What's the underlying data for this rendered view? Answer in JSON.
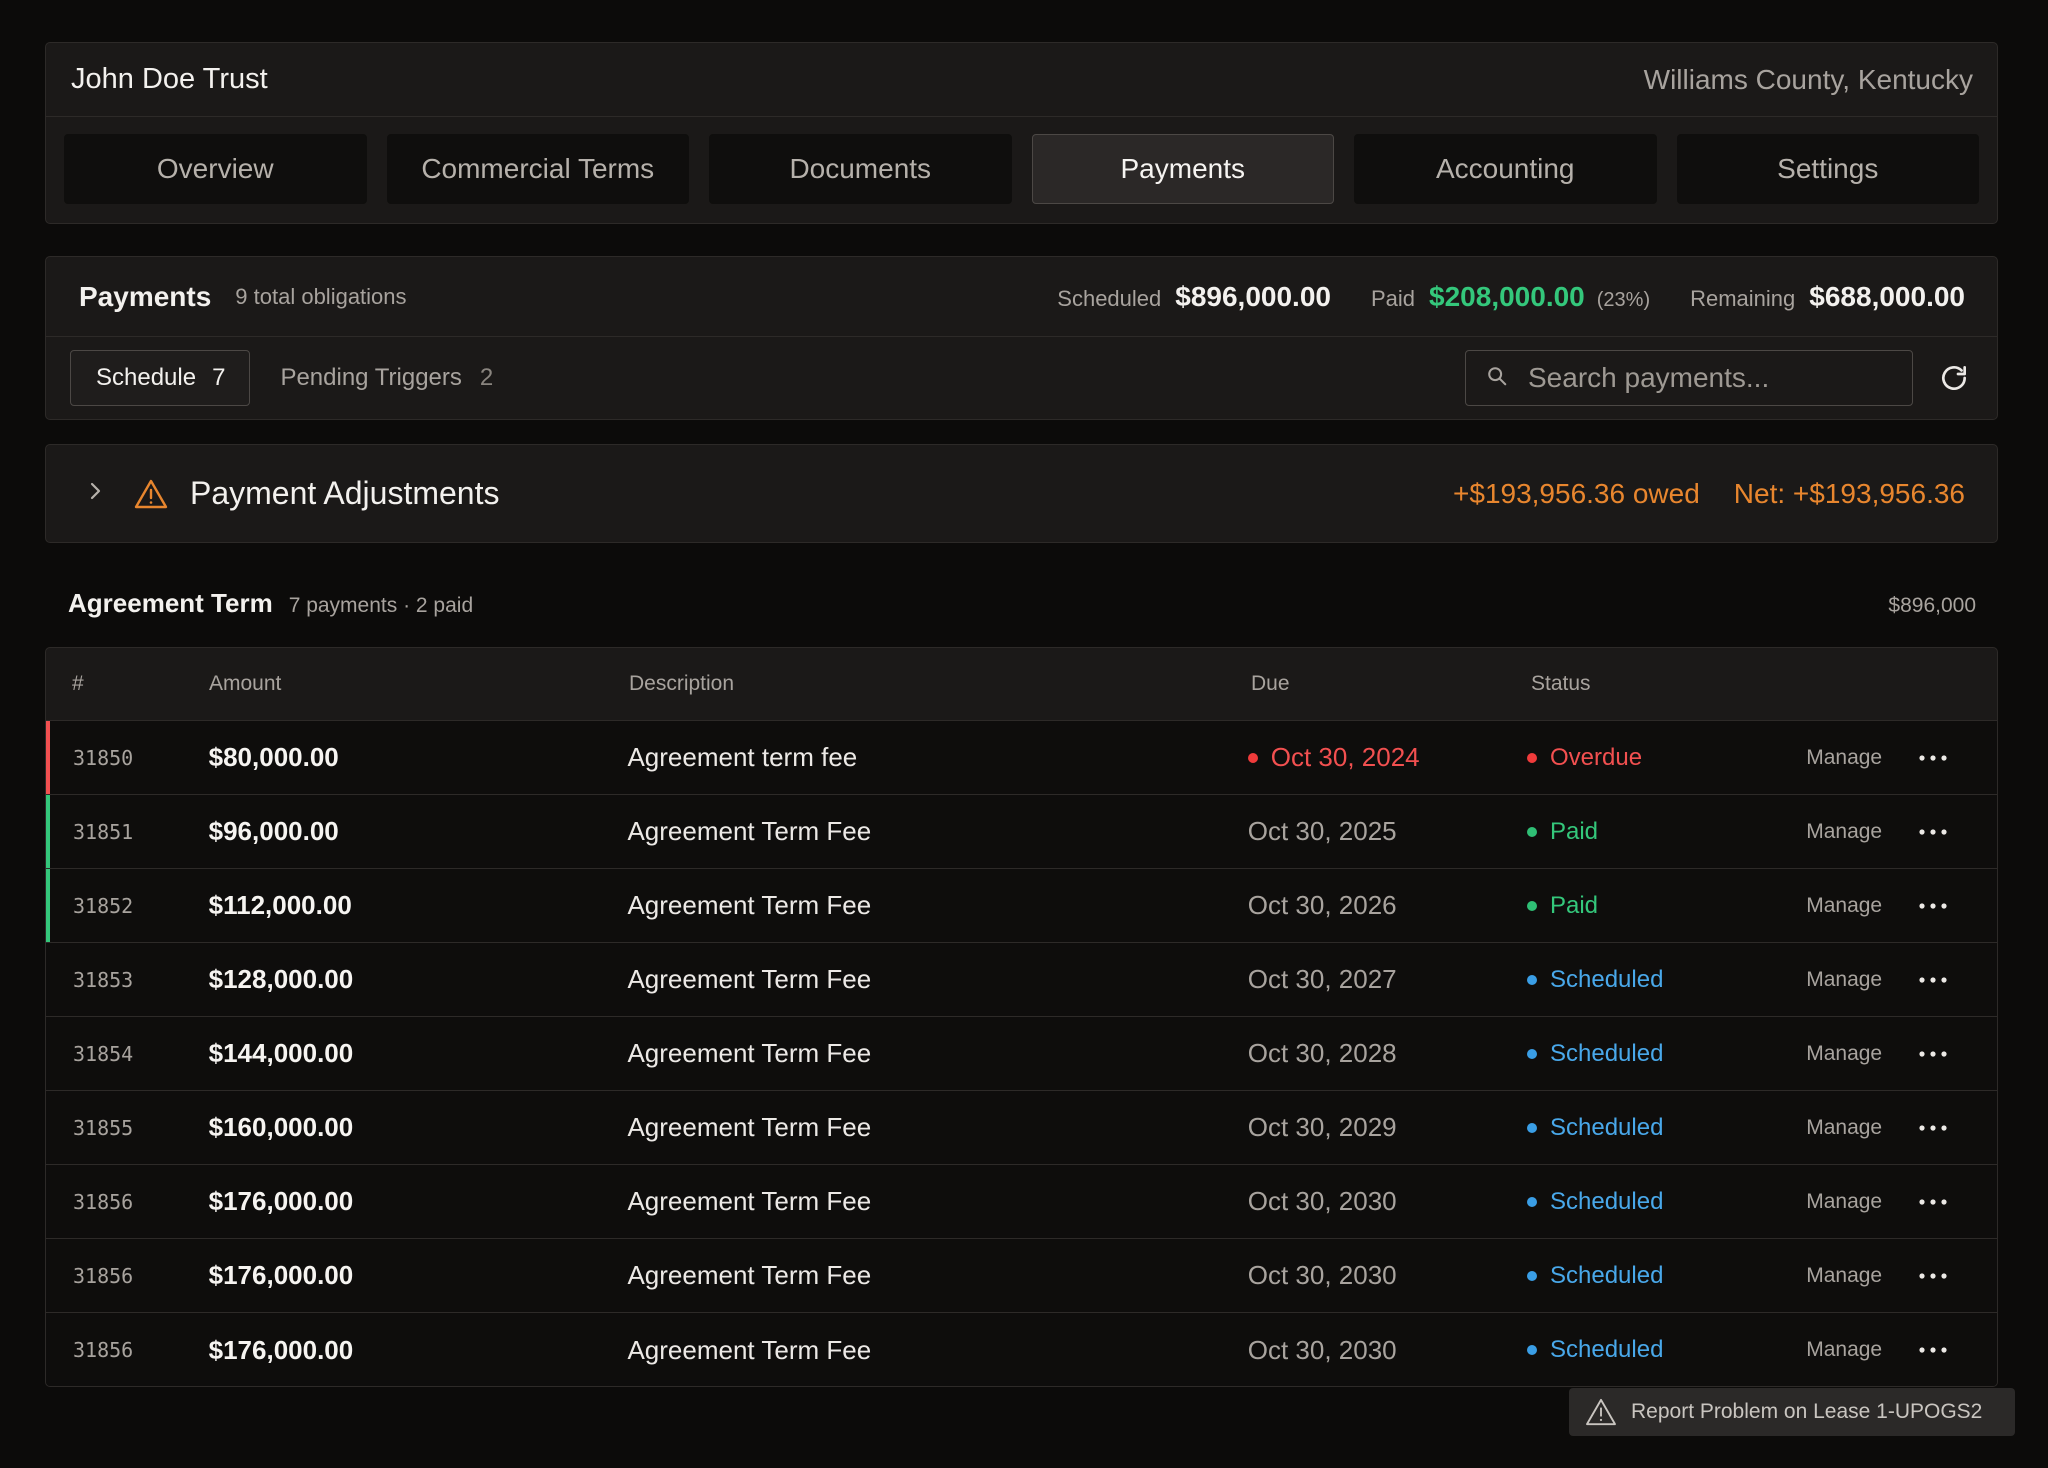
{
  "header": {
    "title": "John Doe Trust",
    "location": "Williams County, Kentucky",
    "tabs": [
      {
        "label": "Overview",
        "active": false
      },
      {
        "label": "Commercial Terms",
        "active": false
      },
      {
        "label": "Documents",
        "active": false
      },
      {
        "label": "Payments",
        "active": true
      },
      {
        "label": "Accounting",
        "active": false
      },
      {
        "label": "Settings",
        "active": false
      }
    ]
  },
  "summary": {
    "title": "Payments",
    "count_text": "9 total obligations",
    "scheduled_label": "Scheduled",
    "scheduled_value": "$896,000.00",
    "paid_label": "Paid",
    "paid_value": "$208,000.00",
    "paid_pct": "(23%)",
    "remaining_label": "Remaining",
    "remaining_value": "$688,000.00",
    "schedule_tab": {
      "label": "Schedule",
      "count": "7"
    },
    "triggers_tab": {
      "label": "Pending Triggers",
      "count": "2"
    },
    "search_placeholder": "Search payments..."
  },
  "adjustments": {
    "title": "Payment Adjustments",
    "owed": "+$193,956.36 owed",
    "net": "Net: +$193,956.36"
  },
  "term": {
    "title": "Agreement Term",
    "subtitle": "7 payments · 2 paid",
    "total": "$896,000"
  },
  "table": {
    "headers": {
      "num": "#",
      "amount": "Amount",
      "description": "Description",
      "due": "Due",
      "status": "Status"
    },
    "manage_label": "Manage",
    "rows": [
      {
        "num": "31850",
        "amount": "$80,000.00",
        "description": "Agreement term fee",
        "due": "Oct 30, 2024",
        "status": "Overdue",
        "kind": "overdue"
      },
      {
        "num": "31851",
        "amount": "$96,000.00",
        "description": "Agreement Term Fee",
        "due": "Oct 30, 2025",
        "status": "Paid",
        "kind": "paid"
      },
      {
        "num": "31852",
        "amount": "$112,000.00",
        "description": "Agreement Term Fee",
        "due": "Oct 30, 2026",
        "status": "Paid",
        "kind": "paid"
      },
      {
        "num": "31853",
        "amount": "$128,000.00",
        "description": "Agreement Term Fee",
        "due": "Oct 30, 2027",
        "status": "Scheduled",
        "kind": "scheduled"
      },
      {
        "num": "31854",
        "amount": "$144,000.00",
        "description": "Agreement Term Fee",
        "due": "Oct 30, 2028",
        "status": "Scheduled",
        "kind": "scheduled"
      },
      {
        "num": "31855",
        "amount": "$160,000.00",
        "description": "Agreement Term Fee",
        "due": "Oct 30, 2029",
        "status": "Scheduled",
        "kind": "scheduled"
      },
      {
        "num": "31856",
        "amount": "$176,000.00",
        "description": "Agreement Term Fee",
        "due": "Oct 30, 2030",
        "status": "Scheduled",
        "kind": "scheduled"
      },
      {
        "num": "31856",
        "amount": "$176,000.00",
        "description": "Agreement Term Fee",
        "due": "Oct 30, 2030",
        "status": "Scheduled",
        "kind": "scheduled"
      },
      {
        "num": "31856",
        "amount": "$176,000.00",
        "description": "Agreement Term Fee",
        "due": "Oct 30, 2030",
        "status": "Scheduled",
        "kind": "scheduled"
      }
    ]
  },
  "report": {
    "label": "Report Problem on Lease 1-UPOGS2"
  },
  "colors": {
    "overdue": "#f25050",
    "paid": "#34c77b",
    "scheduled": "#49a8ea",
    "warning": "#e8862e",
    "background": "#0c0b0a"
  },
  "icons": {
    "search": "search-icon",
    "refresh": "refresh-icon",
    "chevron": "chevron-right-icon",
    "warning": "warning-icon",
    "more": "more-horizontal-icon"
  }
}
